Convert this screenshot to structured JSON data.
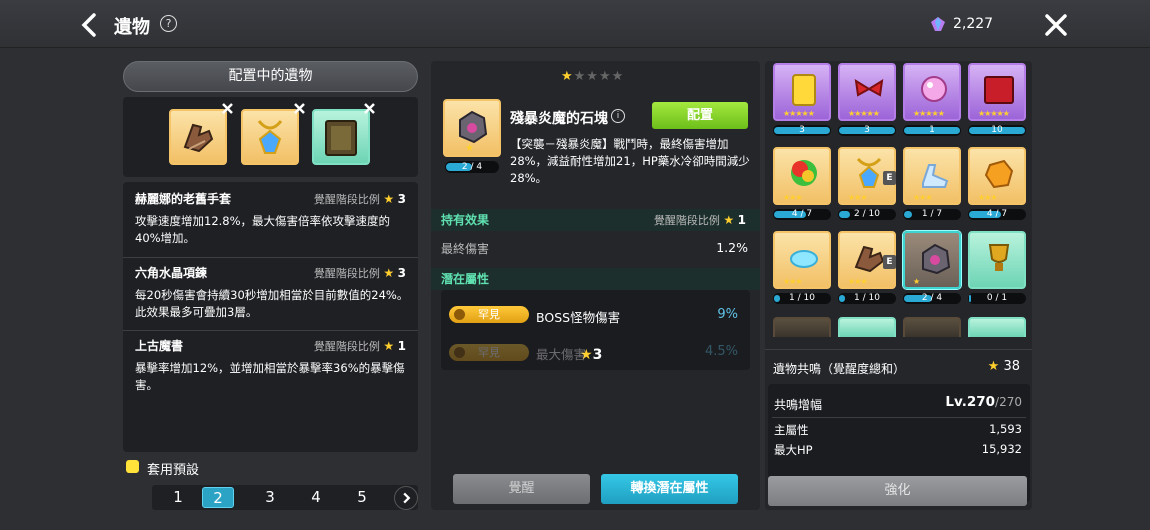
{
  "header": {
    "title": "遺物",
    "help": "?",
    "currency": "2,227"
  },
  "left": {
    "heading": "配置中的遺物",
    "relics": [
      {
        "name": "赫麗娜的老舊手套",
        "ratio_label": "覺醒階段比例",
        "ratio": "3",
        "desc": "攻擊速度增加12.8%，最大傷害倍率依攻擊速度的40%增加。"
      },
      {
        "name": "六角水晶項鍊",
        "ratio_label": "覺醒階段比例",
        "ratio": "3",
        "desc": "每20秒傷害會持續30秒增加相當於目前數值的24%。此效果最多可疊加3層。"
      },
      {
        "name": "上古魔書",
        "ratio_label": "覺醒階段比例",
        "ratio": "1",
        "desc": "暴擊率增加12%，並增加相當於暴擊率36%的暴擊傷害。"
      }
    ],
    "preset_label": "套用預設",
    "pages": [
      "1",
      "2",
      "3",
      "4",
      "5"
    ],
    "active_page": 1
  },
  "detail": {
    "stars_filled": 1,
    "stars_total": 5,
    "name": "殘暴炎魔的石塊",
    "progress": "2 / 4",
    "progress_fraction": 0.5,
    "equip_label": "配置",
    "desc": "【突襲－殘暴炎魔】戰鬥時，最終傷害增加28%，減益耐性增加21，HP藥水冷卻時間減少28%。",
    "owned_label": "持有效果",
    "owned_ratio_label": "覺醒階段比例",
    "owned_ratio": "1",
    "owned_key": "最終傷害",
    "owned_val": "1.2%",
    "potential_label": "潛在屬性",
    "potentials": [
      {
        "grade": "罕見",
        "stat": "BOSS怪物傷害",
        "value": "9%"
      },
      {
        "grade": "罕見",
        "stat": "最大傷害",
        "value": "4.5%",
        "req": "3"
      }
    ],
    "awaken_label": "覺醒",
    "change_label": "轉換潛在屬性"
  },
  "grid": [
    {
      "icon": "scroll-icon",
      "color": "purple",
      "stars": 5,
      "bar": "3",
      "frac": 1.0
    },
    {
      "icon": "bow-icon",
      "color": "purple",
      "stars": 5,
      "bar": "3",
      "frac": 1.0
    },
    {
      "icon": "orb-icon",
      "color": "purple",
      "stars": 5,
      "bar": "1",
      "frac": 1.0
    },
    {
      "icon": "book-icon",
      "color": "purple",
      "stars": 5,
      "bar": "10",
      "frac": 1.0
    },
    {
      "icon": "rainbow-icon",
      "color": "gold",
      "stars": 3,
      "bar": "4 / 7",
      "frac": 0.57
    },
    {
      "icon": "necklace-icon",
      "color": "gold",
      "stars": 3,
      "bar": "2 / 10",
      "frac": 0.2,
      "e": true
    },
    {
      "icon": "glass-shoe-icon",
      "color": "gold",
      "stars": 3,
      "bar": "1 / 7",
      "frac": 0.14
    },
    {
      "icon": "amber-icon",
      "color": "gold",
      "stars": 3,
      "bar": "4 / 7",
      "frac": 0.57
    },
    {
      "icon": "cloud-icon",
      "color": "gold",
      "stars": 3,
      "bar": "1 / 10",
      "frac": 0.1
    },
    {
      "icon": "glove-icon",
      "color": "gold",
      "stars": 3,
      "bar": "1 / 10",
      "frac": 0.1,
      "e": true
    },
    {
      "icon": "stone-icon",
      "color": "sel",
      "stars": 1,
      "bar": "2 / 4",
      "frac": 0.5
    },
    {
      "icon": "trophy-icon",
      "color": "green",
      "stars": 0,
      "bar": "0 / 1",
      "frac": 0.0
    }
  ],
  "resonance": {
    "label": "遺物共鳴（覺醒度總和）",
    "total": "38",
    "level_label": "共鳴增幅",
    "level": "Lv.270",
    "level_max": "/270",
    "stats": [
      {
        "k": "主屬性",
        "v": "1,593"
      },
      {
        "k": "最大HP",
        "v": "15,932"
      }
    ],
    "enhance_label": "強化"
  },
  "colors": {
    "accent": "#2aa3c4",
    "green": "#6cbf1a",
    "star": "#ffcf2e"
  }
}
